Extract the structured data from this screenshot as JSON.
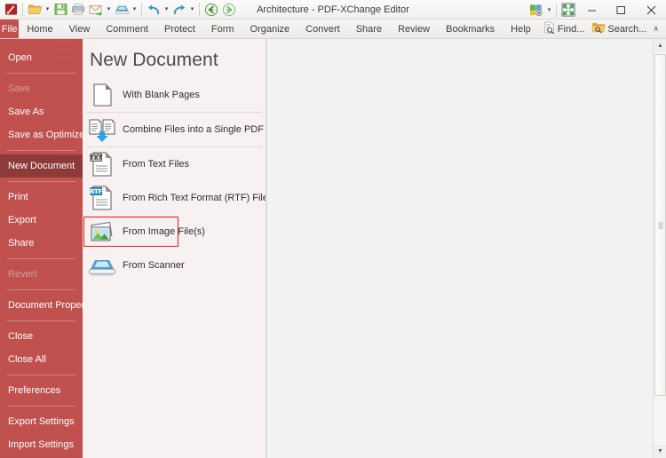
{
  "window": {
    "title": "Architecture - PDF-XChange Editor",
    "controls": [
      {
        "name": "minimize-button",
        "glyph": "—"
      },
      {
        "name": "maximize-button",
        "glyph": "☐"
      },
      {
        "name": "close-button",
        "glyph": "✕"
      }
    ]
  },
  "quick_access": {
    "items": [
      {
        "name": "app-logo-icon",
        "label": "PDF-XChange Editor"
      },
      {
        "name": "open-folder-icon",
        "label": "Open",
        "dropdown": true
      },
      {
        "name": "save-icon",
        "label": "Save",
        "dropdown": false
      },
      {
        "name": "print-icon",
        "label": "Print",
        "dropdown": false
      },
      {
        "name": "email-icon",
        "label": "Email",
        "dropdown": true
      },
      {
        "name": "scanner-icon",
        "label": "From Scanner",
        "dropdown": true
      },
      {
        "name": "undo-icon",
        "label": "Undo",
        "dropdown": true
      },
      {
        "name": "redo-icon",
        "label": "Redo",
        "dropdown": true
      },
      {
        "name": "back-icon",
        "label": "Previous View",
        "dropdown": false
      },
      {
        "name": "forward-icon",
        "label": "Next View",
        "dropdown": false
      }
    ],
    "dropdown_glyph": "▾"
  },
  "titlebar_right": {
    "tools_label": "Tools",
    "fullscreen_label": "Full Screen",
    "dropdown_glyph": "▾"
  },
  "ribbon": {
    "file_tab": "File",
    "tabs": [
      "Home",
      "View",
      "Comment",
      "Protect",
      "Form",
      "Organize",
      "Convert",
      "Share",
      "Review",
      "Bookmarks",
      "Help"
    ],
    "right_items": [
      {
        "name": "find-button",
        "label": "Find...",
        "icon": "find-icon"
      },
      {
        "name": "search-button",
        "label": "Search...",
        "icon": "search-folder-icon"
      }
    ],
    "collapse_glyph": "∧"
  },
  "sidebar": {
    "groups": [
      {
        "items": [
          {
            "label": "Open",
            "state": "normal",
            "name": "sidebar-item-open"
          }
        ]
      },
      {
        "items": [
          {
            "label": "Save",
            "state": "disabled",
            "name": "sidebar-item-save"
          },
          {
            "label": "Save As",
            "state": "normal",
            "name": "sidebar-item-save-as"
          },
          {
            "label": "Save as Optimized",
            "state": "normal",
            "name": "sidebar-item-save-as-optimized"
          }
        ]
      },
      {
        "items": [
          {
            "label": "New Document",
            "state": "active",
            "name": "sidebar-item-new-document"
          }
        ]
      },
      {
        "items": [
          {
            "label": "Print",
            "state": "normal",
            "name": "sidebar-item-print"
          },
          {
            "label": "Export",
            "state": "normal",
            "name": "sidebar-item-export"
          },
          {
            "label": "Share",
            "state": "normal",
            "name": "sidebar-item-share"
          }
        ]
      },
      {
        "items": [
          {
            "label": "Revert",
            "state": "disabled",
            "name": "sidebar-item-revert"
          }
        ]
      },
      {
        "items": [
          {
            "label": "Document Properties",
            "state": "normal",
            "name": "sidebar-item-document-properties"
          }
        ]
      },
      {
        "items": [
          {
            "label": "Close",
            "state": "normal",
            "name": "sidebar-item-close"
          },
          {
            "label": "Close All",
            "state": "normal",
            "name": "sidebar-item-close-all"
          }
        ]
      },
      {
        "items": [
          {
            "label": "Preferences",
            "state": "normal",
            "name": "sidebar-item-preferences"
          }
        ]
      },
      {
        "items": [
          {
            "label": "Export Settings",
            "state": "normal",
            "name": "sidebar-item-export-settings"
          },
          {
            "label": "Import Settings",
            "state": "normal",
            "name": "sidebar-item-import-settings"
          }
        ]
      }
    ]
  },
  "panel": {
    "title": "New Document",
    "entries": [
      {
        "label": "With Blank Pages",
        "icon": "blank-page-icon",
        "name": "new-doc-with-blank-pages",
        "selected": false,
        "separator_after": true
      },
      {
        "label": "Combine Files into a Single PDF",
        "icon": "combine-files-icon",
        "name": "new-doc-combine-files",
        "selected": false,
        "separator_after": true
      },
      {
        "label": "From Text Files",
        "icon": "txt-file-icon",
        "name": "new-doc-from-text-files",
        "selected": false,
        "separator_after": false
      },
      {
        "label": "From Rich Text Format (RTF) Files",
        "icon": "rtf-file-icon",
        "name": "new-doc-from-rtf-files",
        "selected": false,
        "separator_after": false
      },
      {
        "label": "From Image File(s)",
        "icon": "image-file-icon",
        "name": "new-doc-from-image-files",
        "selected": true,
        "separator_after": false
      },
      {
        "label": "From Scanner",
        "icon": "scanner-icon",
        "name": "new-doc-from-scanner",
        "selected": false,
        "separator_after": false
      }
    ]
  },
  "scrollbar": {
    "up_glyph": "▲",
    "down_glyph": "▼"
  },
  "colors": {
    "brand_red": "#c0504d",
    "active_red": "#8c3a38",
    "selection_outline": "#e01b1b",
    "panel_bg": "#f7f1f1",
    "content_bg": "#f2f2f2"
  }
}
